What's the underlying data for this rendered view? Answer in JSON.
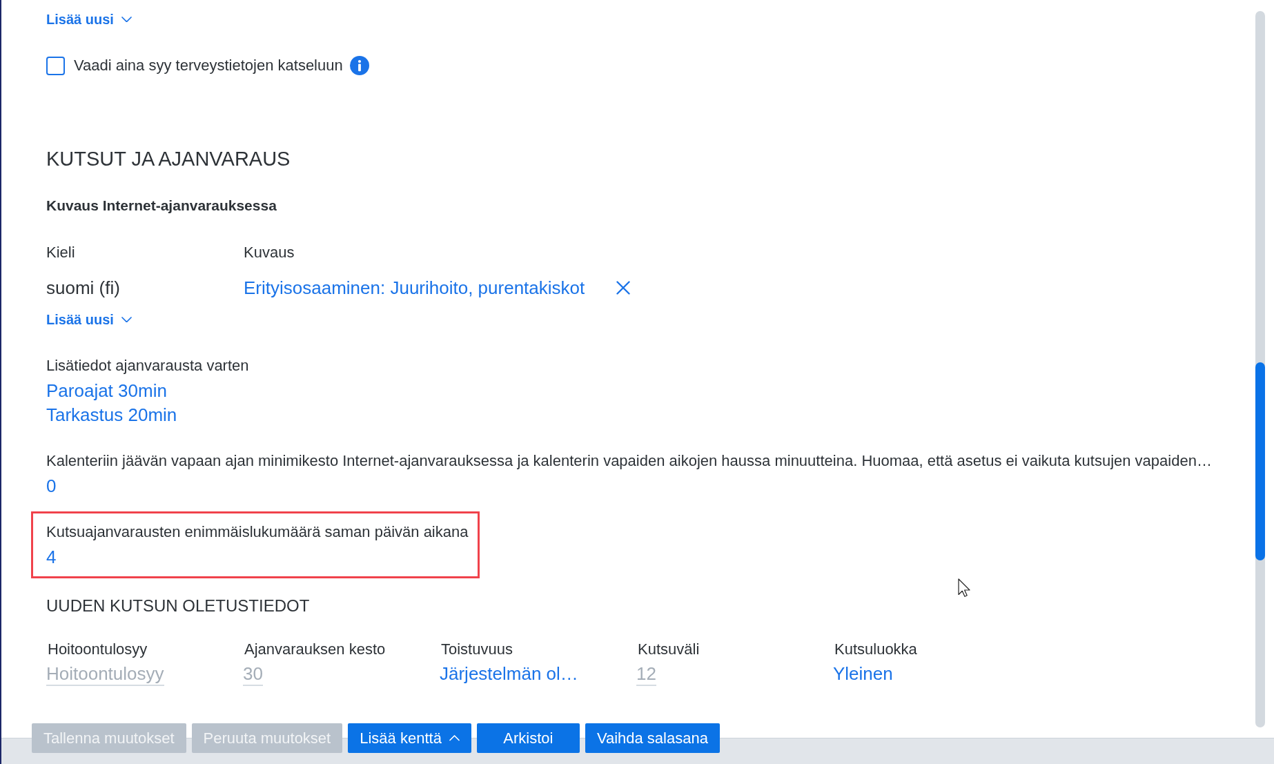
{
  "previous_section": {
    "add_new": {
      "label": "Lisää uusi"
    }
  },
  "require_reason": {
    "label": "Vaadi aina syy terveystietojen katseluun",
    "checked": false
  },
  "appointments_section": {
    "title": "KUTSUT JA AJANVARAUS",
    "internet_description": {
      "title": "Kuvaus Internet-ajanvarauksessa",
      "columns": [
        "Kieli",
        "Kuvaus"
      ],
      "rows": [
        {
          "language": "suomi (fi)",
          "description": "Erityisosaaminen: Juurihoito, purentakiskot"
        }
      ],
      "add_new": {
        "label": "Lisää uusi"
      }
    },
    "fields": [
      {
        "label": "Lisätiedot ajanvarausta varten",
        "values": [
          "Paroajat 30min",
          "Tarkastus 20min"
        ],
        "highlighted": false
      },
      {
        "label": "Kalenteriin jäävän vapaan ajan minimikesto Internet-ajanvarauksessa ja kalenterin vapaiden aikojen haussa minuutteina. Huomaa, että asetus ei vaikuta kutsujen vapaiden…",
        "values": [
          "0"
        ],
        "highlighted": false
      },
      {
        "label": "Kutsuajanvarausten enimmäislukumäärä saman päivän aikana",
        "values": [
          "4"
        ],
        "highlighted": true
      }
    ]
  },
  "new_invitation_defaults": {
    "title": "UUDEN KUTSUN OLETUSTIEDOT",
    "fields": [
      {
        "label": "Hoitoontulosyy",
        "kind": "input",
        "placeholder": "Hoitoontulosyy"
      },
      {
        "label": "Ajanvarauksen kesto",
        "kind": "input",
        "placeholder": "30"
      },
      {
        "label": "Toistuvuus",
        "kind": "link",
        "value": "Järjestelmän ol…"
      },
      {
        "label": "Kutsuväli",
        "kind": "input",
        "placeholder": "12"
      },
      {
        "label": "Kutsuluokka",
        "kind": "link",
        "value": "Yleinen"
      }
    ]
  },
  "buttons": [
    {
      "label": "Tallenna muutokset",
      "kind": "action",
      "disabled": true
    },
    {
      "label": "Peruuta muutokset",
      "kind": "action",
      "disabled": true
    },
    {
      "label": "Lisää kenttä",
      "kind": "menu",
      "disabled": false
    },
    {
      "label": "Arkistoi",
      "kind": "action",
      "disabled": false
    },
    {
      "label": "Vaihda salasana",
      "kind": "action",
      "disabled": false
    }
  ]
}
